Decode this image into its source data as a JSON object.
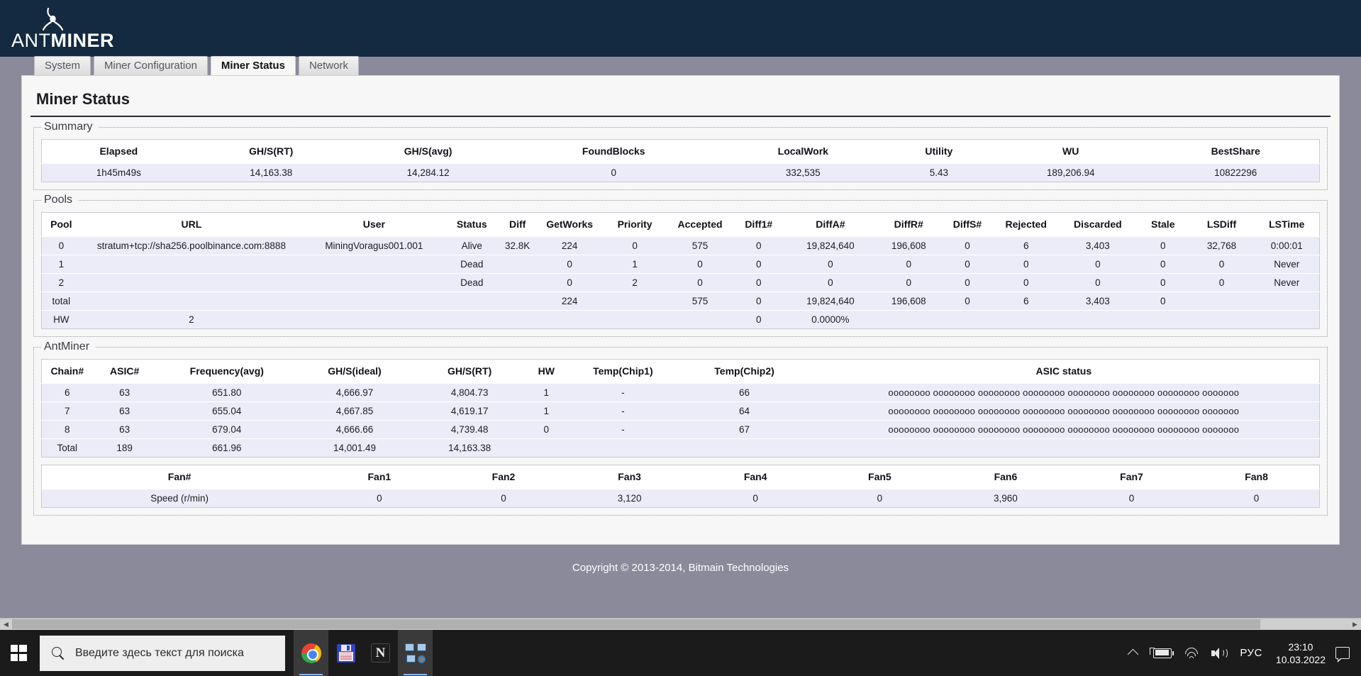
{
  "brand": {
    "name_light": "ANT",
    "name_bold": "MINER",
    "icon": "ant-logo-icon"
  },
  "tabs": [
    {
      "label": "System",
      "active": false
    },
    {
      "label": "Miner Configuration",
      "active": false
    },
    {
      "label": "Miner Status",
      "active": true
    },
    {
      "label": "Network",
      "active": false
    }
  ],
  "page": {
    "title": "Miner Status"
  },
  "summary": {
    "legend": "Summary",
    "headers": [
      "Elapsed",
      "GH/S(RT)",
      "GH/S(avg)",
      "FoundBlocks",
      "LocalWork",
      "Utility",
      "WU",
      "BestShare"
    ],
    "row": [
      "1h45m49s",
      "14,163.38",
      "14,284.12",
      "0",
      "332,535",
      "5.43",
      "189,206.94",
      "10822296"
    ]
  },
  "pools": {
    "legend": "Pools",
    "headers": [
      "Pool",
      "URL",
      "User",
      "Status",
      "Diff",
      "GetWorks",
      "Priority",
      "Accepted",
      "Diff1#",
      "DiffA#",
      "DiffR#",
      "DiffS#",
      "Rejected",
      "Discarded",
      "Stale",
      "LSDiff",
      "LSTime"
    ],
    "rows": [
      [
        "0",
        "stratum+tcp://sha256.poolbinance.com:8888",
        "MiningVoragus001.001",
        "Alive",
        "32.8K",
        "224",
        "0",
        "575",
        "0",
        "19,824,640",
        "196,608",
        "0",
        "6",
        "3,403",
        "0",
        "32,768",
        "0:00:01"
      ],
      [
        "1",
        "",
        "",
        "Dead",
        "",
        "0",
        "1",
        "0",
        "0",
        "0",
        "0",
        "0",
        "0",
        "0",
        "0",
        "0",
        "Never"
      ],
      [
        "2",
        "",
        "",
        "Dead",
        "",
        "0",
        "2",
        "0",
        "0",
        "0",
        "0",
        "0",
        "0",
        "0",
        "0",
        "0",
        "Never"
      ],
      [
        "total",
        "",
        "",
        "",
        "",
        "224",
        "",
        "575",
        "0",
        "19,824,640",
        "196,608",
        "0",
        "6",
        "3,403",
        "0",
        "",
        ""
      ],
      [
        "HW",
        "2",
        "",
        "",
        "",
        "",
        "",
        "",
        "0",
        "0.0000%",
        "",
        "",
        "",
        "",
        "",
        "",
        ""
      ]
    ]
  },
  "antminer": {
    "legend": "AntMiner",
    "headers": [
      "Chain#",
      "ASIC#",
      "Frequency(avg)",
      "GH/S(ideal)",
      "GH/S(RT)",
      "HW",
      "Temp(Chip1)",
      "Temp(Chip2)",
      "ASIC status"
    ],
    "asic_status_text": "oooooooo oooooooo oooooooo oooooooo oooooooo oooooooo oooooooo ooooooo",
    "rows": [
      [
        "6",
        "63",
        "651.80",
        "4,666.97",
        "4,804.73",
        "1",
        "-",
        "66",
        "oooooooo oooooooo oooooooo oooooooo oooooooo oooooooo oooooooo ooooooo"
      ],
      [
        "7",
        "63",
        "655.04",
        "4,667.85",
        "4,619.17",
        "1",
        "-",
        "64",
        "oooooooo oooooooo oooooooo oooooooo oooooooo oooooooo oooooooo ooooooo"
      ],
      [
        "8",
        "63",
        "679.04",
        "4,666.66",
        "4,739.48",
        "0",
        "-",
        "67",
        "oooooooo oooooooo oooooooo oooooooo oooooooo oooooooo oooooooo ooooooo"
      ],
      [
        "Total",
        "189",
        "661.96",
        "14,001.49",
        "14,163.38",
        "",
        "",
        "",
        ""
      ]
    ]
  },
  "fans": {
    "headers": [
      "Fan#",
      "Fan1",
      "Fan2",
      "Fan3",
      "Fan4",
      "Fan5",
      "Fan6",
      "Fan7",
      "Fan8"
    ],
    "row_label": "Speed (r/min)",
    "values": [
      "0",
      "0",
      "3,120",
      "0",
      "0",
      "3,960",
      "0",
      "0"
    ]
  },
  "footer": {
    "copyright": "Copyright © 2013-2014, Bitmain Technologies"
  },
  "taskbar": {
    "start": "start-button",
    "search_placeholder": "Введите здесь текст для поиска",
    "apps": [
      {
        "name": "chrome",
        "running": true
      },
      {
        "name": "save-floppy",
        "running": false
      },
      {
        "name": "n-app",
        "running": false
      },
      {
        "name": "network-monitor",
        "running": true
      }
    ],
    "tray": {
      "show_hidden": "chevron-up-icon",
      "battery": "battery-charging-icon",
      "network": "wifi-icon",
      "volume": "speaker-icon",
      "language": "РУС",
      "time": "23:10",
      "date": "10.03.2022",
      "action_center": "notification-icon"
    }
  },
  "colors": {
    "header_bg": "#132a40",
    "desktop_bg": "#8b8a9b",
    "card_bg": "#f7f7f7",
    "row_bg": "#eceef9",
    "taskbar_bg": "#1b1b1b"
  }
}
